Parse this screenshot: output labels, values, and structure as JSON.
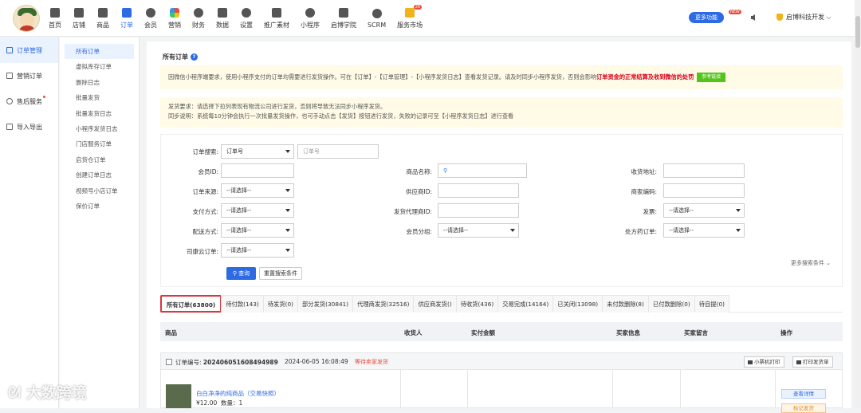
{
  "nav": [
    {
      "label": "首页",
      "icon": "home-icon"
    },
    {
      "label": "店铺",
      "icon": "store-icon"
    },
    {
      "label": "商品",
      "icon": "goods-icon"
    },
    {
      "label": "订单",
      "icon": "order-icon",
      "active": true
    },
    {
      "label": "会员",
      "icon": "member-icon"
    },
    {
      "label": "营销",
      "icon": "marketing-icon"
    },
    {
      "label": "财务",
      "icon": "finance-icon"
    },
    {
      "label": "数据",
      "icon": "data-icon"
    },
    {
      "label": "设置",
      "icon": "settings-icon"
    },
    {
      "label": "推广素材",
      "icon": "share-icon"
    },
    {
      "label": "小程序",
      "icon": "miniapp-icon"
    },
    {
      "label": "启博学院",
      "icon": "academy-icon"
    },
    {
      "label": "SCRM",
      "icon": "scrm-icon"
    },
    {
      "label": "服务市场",
      "icon": "market-icon",
      "badge": "26"
    }
  ],
  "header": {
    "more_func": "更多功能",
    "new_tag": "NEW",
    "shop_name": "启博科技开发"
  },
  "sidebar1": [
    {
      "label": "订单管理",
      "active": true
    },
    {
      "label": "营销订单"
    },
    {
      "label": "售后服务",
      "dot": true
    },
    {
      "label": "导入导出"
    }
  ],
  "sidebar2": [
    {
      "label": "所有订单",
      "active": true
    },
    {
      "label": "虚拟库存订单"
    },
    {
      "label": "删除日志"
    },
    {
      "label": "批量发货"
    },
    {
      "label": "批量发货日志"
    },
    {
      "label": "小程序发货日志"
    },
    {
      "label": "门店服务订单"
    },
    {
      "label": "启货仓订单"
    },
    {
      "label": "创建订单日志"
    },
    {
      "label": "视频号小店订单"
    },
    {
      "label": "保价订单"
    }
  ],
  "page": {
    "title": "所有订单",
    "notice1_text": "因微信小程序端要求，使用小程序支付的订单均需要进行发货操作。可在【订单】-【订单管理】-【小程序发货日志】查看发货记录。请及时同步小程序发货，否则会影响",
    "notice1_highlight": "订单资金的正常结算及收到微信的处罚",
    "notice1_btn": "参考链接",
    "notice2_line1": "发货要求：请选择下拉列表现有物流公司进行发货，否则将导致无法同步小程序发货。",
    "notice2_line2": "同步说明：系统每10分钟会执行一次批量发货操作，也可手动点击【发货】按钮进行发货，失败的记录可至【小程序发货日志】进行查看"
  },
  "filter": {
    "order_search_label": "订单搜索:",
    "order_search_select": "订单号",
    "order_search_placeholder": "订单号",
    "member_id_label": "会员ID:",
    "product_name_label": "商品名称:",
    "address_label": "收货地址:",
    "order_source_label": "订单来源:",
    "supplier_id_label": "供应商ID:",
    "merchant_code_label": "商家编码:",
    "pay_method_label": "支付方式:",
    "agent_id_label": "发货代理商ID:",
    "invoice_label": "发票:",
    "delivery_label": "配送方式:",
    "member_group_label": "会员分组:",
    "rx_order_label": "处方药订单:",
    "sikang_label": "司康云订单:",
    "placeholder_select": "--请选择--",
    "query_btn": "查询",
    "reset_btn": "重置搜索条件",
    "more_search": "更多搜索条件"
  },
  "tabs": [
    {
      "label": "所有订单(63800)",
      "active": true
    },
    {
      "label": "待付款(143)"
    },
    {
      "label": "待发货(0)"
    },
    {
      "label": "部分发货(30841)"
    },
    {
      "label": "代理商发货(32516)"
    },
    {
      "label": "供应商发货()"
    },
    {
      "label": "待收货(436)"
    },
    {
      "label": "交易完成(14164)"
    },
    {
      "label": "已关闭(13098)"
    },
    {
      "label": "未付款删除(8)"
    },
    {
      "label": "已付款删除(0)"
    },
    {
      "label": "待自提(0)"
    }
  ],
  "table_header": [
    "商品",
    "收货人",
    "实付金额",
    "买家信息",
    "买家留言",
    "操作"
  ],
  "order": {
    "no_label": "订单编号:",
    "no": "202406051608494989",
    "time": "2024-06-05 16:08:49",
    "status": "等待卖家发货",
    "btn_small_print": "小票机打印",
    "btn_print_ship": "打印发货单",
    "product_name": "白白净净的纯商品（交易快照）",
    "product_price": "¥12.00",
    "product_qty": "数量：1",
    "act_view": "查看详情",
    "act_mark": "标记发货"
  },
  "watermark": "大数跨境"
}
